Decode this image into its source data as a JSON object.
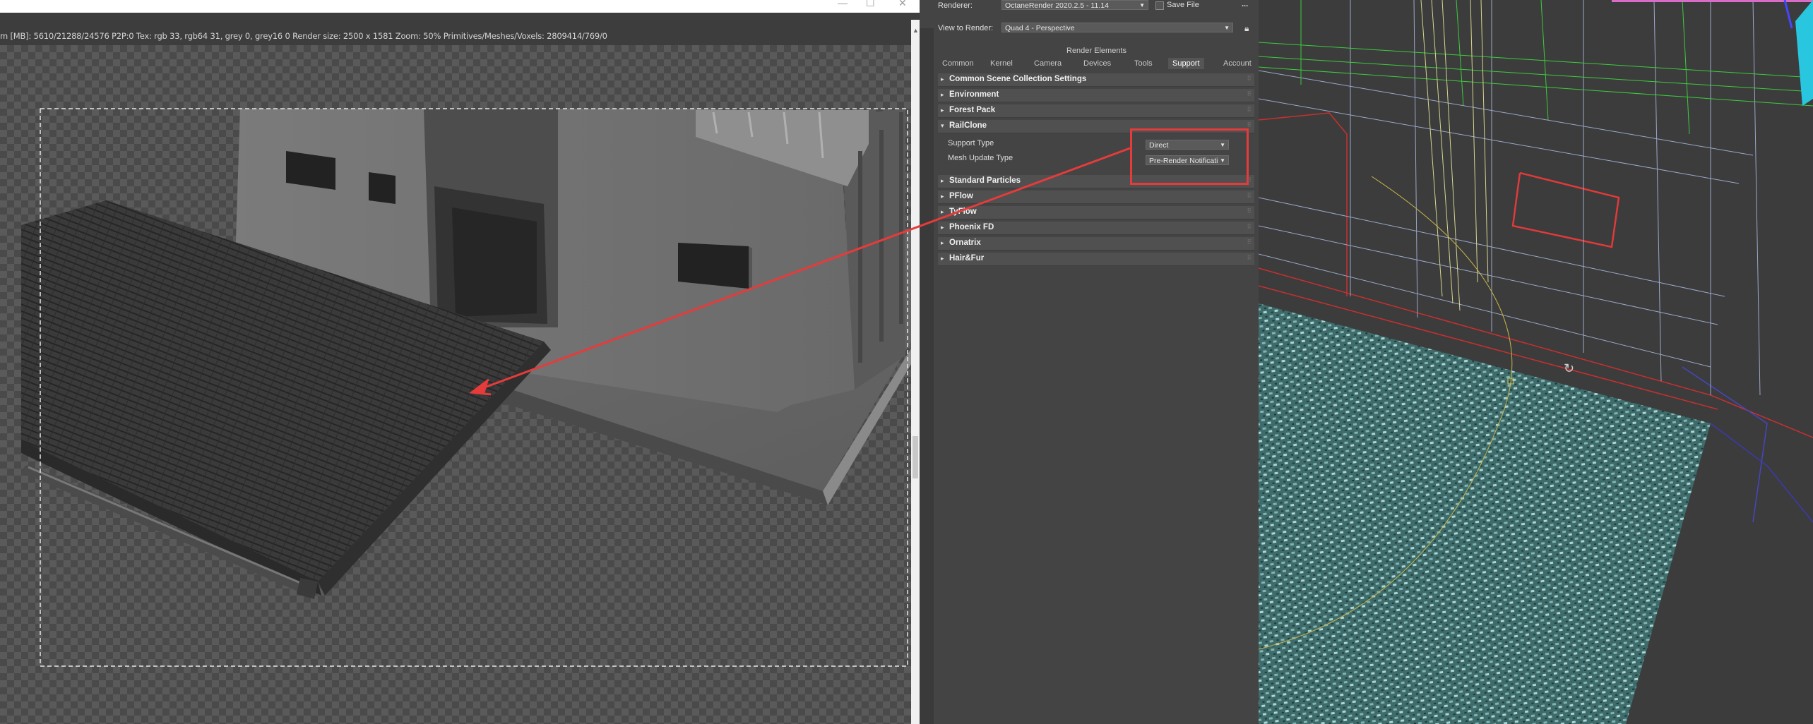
{
  "framebuffer": {
    "info_line": "m [MB]: 5610/21288/24576 P2P:0   Tex: rgb 33, rgb64 31, grey 0, grey16 0    Render size: 2500 x 1581    Zoom: 50%    Primitives/Meshes/Voxels: 2809414/769/0"
  },
  "render_setup": {
    "renderer_label": "Renderer:",
    "renderer_value": "OctaneRender 2020.2.5 - 11.14",
    "save_file_label": "Save File",
    "more_button": "...",
    "view_label": "View to Render:",
    "view_value": "Quad 4 - Perspective",
    "render_elements": "Render Elements",
    "tabs": [
      "Common",
      "Kernel",
      "Camera",
      "Devices",
      "Tools",
      "Support",
      "Account"
    ],
    "active_tab": "Support",
    "rollouts": [
      {
        "label": "Common Scene Collection Settings",
        "expanded": false
      },
      {
        "label": "Environment",
        "expanded": false
      },
      {
        "label": "Forest Pack",
        "expanded": false
      },
      {
        "label": "RailClone",
        "expanded": true
      },
      {
        "label": "Standard Particles",
        "expanded": false
      },
      {
        "label": "PFlow",
        "expanded": false
      },
      {
        "label": "TyFlow",
        "expanded": false
      },
      {
        "label": "Phoenix FD",
        "expanded": false
      },
      {
        "label": "Ornatrix",
        "expanded": false
      },
      {
        "label": "Hair&Fur",
        "expanded": false
      }
    ],
    "railclone": {
      "support_type_label": "Support Type",
      "support_type_value": "Direct",
      "mesh_update_label": "Mesh Update Type",
      "mesh_update_value": "Pre-Render Notificati"
    }
  },
  "colors": {
    "annotation": "#e63b3b",
    "panel_bg": "#444444",
    "viewport_bg": "#3c3c3c"
  },
  "icons": [
    "minimize-icon",
    "maximize-icon",
    "close-icon",
    "lock-icon",
    "orbit-icon",
    "dropdown-arrow-icon",
    "collapse-triangle-icon"
  ]
}
